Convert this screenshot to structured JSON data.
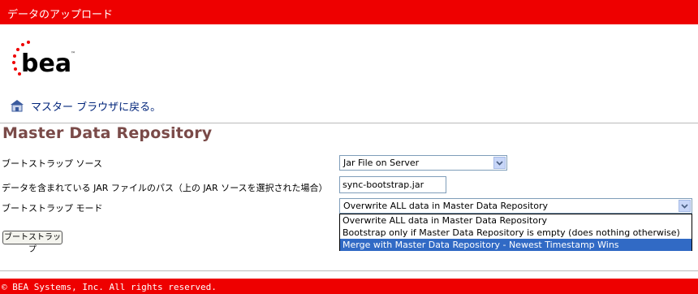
{
  "header": {
    "title": "データのアップロード"
  },
  "logo": {
    "text": "bea",
    "trademark": "™"
  },
  "nav": {
    "home_link": "マスター ブラウザに戻る。"
  },
  "page_title": "Master Data Repository",
  "form": {
    "source_label": "ブートストラップ ソース",
    "source_value": "Jar File on Server",
    "jar_path_label": "データを含まれている JAR ファイルのパス（上の JAR ソースを選択された場合）",
    "jar_path_value": "sync-bootstrap.jar",
    "mode_label": "ブートストラップ モード",
    "mode_value": "Overwrite ALL data in Master Data Repository",
    "mode_options": [
      "Overwrite ALL data in Master Data Repository",
      "Bootstrap only if Master Data Repository is empty (does nothing otherwise)",
      "Merge with Master Data Repository - Newest Timestamp Wins"
    ],
    "highlighted_option_index": 2,
    "submit_label": "ブートストラップ"
  },
  "footer": {
    "copyright": "© BEA Systems, Inc.  All rights reserved."
  },
  "colors": {
    "bar": "#ee0000",
    "title": "#7a4a48",
    "link": "#00247a",
    "selection": "#316ac5"
  }
}
